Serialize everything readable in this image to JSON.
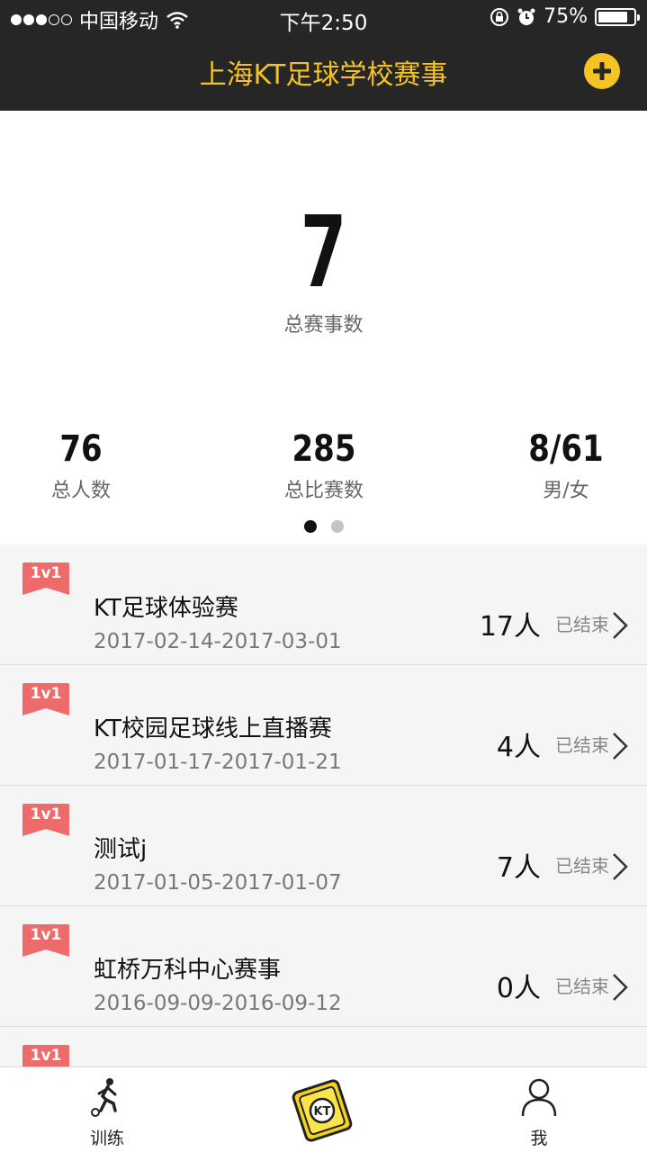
{
  "status_bar": {
    "carrier": "中国移动",
    "time": "下午2:50",
    "battery": "75%"
  },
  "header": {
    "title": "上海KT足球学校赛事",
    "add_icon": "plus-circle-icon"
  },
  "summary": {
    "total_events": "7",
    "total_events_label": "总赛事数",
    "stats": [
      {
        "value": "76",
        "label": "总人数"
      },
      {
        "value": "285",
        "label": "总比赛数"
      },
      {
        "value": "8/61",
        "label": "男/女"
      }
    ],
    "pager_active": 0
  },
  "events": [
    {
      "badge": "1v1",
      "name": "KT足球体验赛",
      "dates": "2017-02-14-2017-03-01",
      "count": "17人",
      "status": "已结束"
    },
    {
      "badge": "1v1",
      "name": "KT校园足球线上直播赛",
      "dates": "2017-01-17-2017-01-21",
      "count": "4人",
      "status": "已结束"
    },
    {
      "badge": "1v1",
      "name": "测试j",
      "dates": "2017-01-05-2017-01-07",
      "count": "7人",
      "status": "已结束"
    },
    {
      "badge": "1v1",
      "name": "虹桥万科中心赛事",
      "dates": "2016-09-09-2016-09-12",
      "count": "0人",
      "status": "已结束"
    },
    {
      "badge": "1v1"
    }
  ],
  "tabs": [
    {
      "label": "训练",
      "icon": "soccer-player-icon"
    },
    {
      "label": "",
      "icon": "kt-logo-icon"
    },
    {
      "label": "我",
      "icon": "user-icon"
    }
  ],
  "colors": {
    "header_bg": "#262626",
    "accent_yellow": "#f5c423",
    "ribbon_red": "#ee6b6b"
  }
}
